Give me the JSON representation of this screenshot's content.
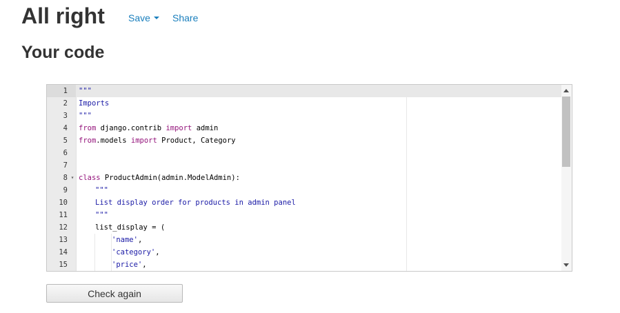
{
  "header": {
    "title": "All right",
    "save_label": "Save",
    "share_label": "Share"
  },
  "section": {
    "title": "Your code"
  },
  "editor": {
    "active_line": 1,
    "lines": [
      {
        "n": "1",
        "fold": false,
        "indent": 0,
        "tokens": [
          {
            "t": "\"\"\"",
            "c": "str"
          }
        ]
      },
      {
        "n": "2",
        "fold": false,
        "indent": 0,
        "tokens": [
          {
            "t": "Imports",
            "c": "str"
          }
        ]
      },
      {
        "n": "3",
        "fold": false,
        "indent": 0,
        "tokens": [
          {
            "t": "\"\"\"",
            "c": "str"
          }
        ]
      },
      {
        "n": "4",
        "fold": false,
        "indent": 0,
        "tokens": [
          {
            "t": "from",
            "c": "kw"
          },
          {
            "t": " django.contrib ",
            "c": "plain"
          },
          {
            "t": "import",
            "c": "kw"
          },
          {
            "t": " admin",
            "c": "plain"
          }
        ]
      },
      {
        "n": "5",
        "fold": false,
        "indent": 0,
        "tokens": [
          {
            "t": "from",
            "c": "kw"
          },
          {
            "t": ".models ",
            "c": "plain"
          },
          {
            "t": "import",
            "c": "kw"
          },
          {
            "t": " Product, Category",
            "c": "plain"
          }
        ]
      },
      {
        "n": "6",
        "fold": false,
        "indent": 0,
        "tokens": []
      },
      {
        "n": "7",
        "fold": false,
        "indent": 0,
        "tokens": []
      },
      {
        "n": "8",
        "fold": true,
        "indent": 0,
        "tokens": [
          {
            "t": "class",
            "c": "kw"
          },
          {
            "t": " ProductAdmin(admin.ModelAdmin):",
            "c": "plain"
          }
        ]
      },
      {
        "n": "9",
        "fold": false,
        "indent": 1,
        "tokens": [
          {
            "t": "\"\"\"",
            "c": "str"
          }
        ]
      },
      {
        "n": "10",
        "fold": false,
        "indent": 1,
        "tokens": [
          {
            "t": "List display order for products in admin panel",
            "c": "str"
          }
        ]
      },
      {
        "n": "11",
        "fold": false,
        "indent": 1,
        "tokens": [
          {
            "t": "\"\"\"",
            "c": "str"
          }
        ]
      },
      {
        "n": "12",
        "fold": false,
        "indent": 1,
        "tokens": [
          {
            "t": "list_display = (",
            "c": "plain"
          }
        ]
      },
      {
        "n": "13",
        "fold": false,
        "indent": 2,
        "tokens": [
          {
            "t": "'name'",
            "c": "str"
          },
          {
            "t": ",",
            "c": "plain"
          }
        ]
      },
      {
        "n": "14",
        "fold": false,
        "indent": 2,
        "tokens": [
          {
            "t": "'category'",
            "c": "str"
          },
          {
            "t": ",",
            "c": "plain"
          }
        ]
      },
      {
        "n": "15",
        "fold": false,
        "indent": 2,
        "tokens": [
          {
            "t": "'price'",
            "c": "str"
          },
          {
            "t": ",",
            "c": "plain"
          }
        ]
      }
    ]
  },
  "check_button_label": "Check again",
  "colors": {
    "link": "#1a7fbd",
    "string": "#1a1aa6",
    "keyword": "#93127a"
  },
  "icons": {
    "save_dropdown": "caret-down-icon",
    "fold_marker": "fold-arrow-icon",
    "scroll_up": "arrow-up-icon",
    "scroll_down": "arrow-down-icon"
  }
}
